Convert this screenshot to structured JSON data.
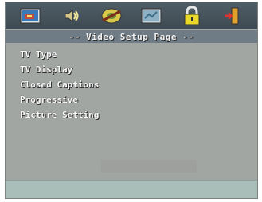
{
  "window": {
    "title": "-- Video Setup Page --"
  },
  "toolbar": {
    "icons": [
      {
        "name": "general-setup-icon",
        "color": "#c44a3c"
      },
      {
        "name": "audio-setup-icon",
        "color": "#d3c88a"
      },
      {
        "name": "video-setup-icon",
        "color": "#d8c94a"
      },
      {
        "name": "preference-icon",
        "color": "#8db0c4"
      },
      {
        "name": "password-lock-icon",
        "color": "#e7d82a"
      },
      {
        "name": "exit-icon",
        "color": "#e0a22b"
      }
    ]
  },
  "menu": {
    "items": [
      {
        "label": "TV Type"
      },
      {
        "label": "TV Display"
      },
      {
        "label": "Closed Captions"
      },
      {
        "label": "Progressive"
      },
      {
        "label": "Picture Setting"
      }
    ]
  },
  "colors": {
    "background": "#a2a6a2",
    "iconbar": "#46525a",
    "titlebar": "#6f7c86",
    "footer": "#a9bdb9",
    "text": "#f8f8f8"
  }
}
